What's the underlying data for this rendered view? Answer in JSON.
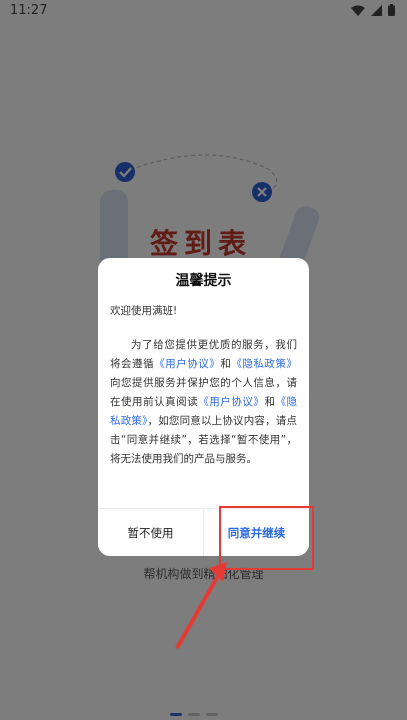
{
  "status_bar": {
    "time": "11:27",
    "icons": [
      "wifi-icon",
      "cellular-signal-icon",
      "battery-icon"
    ]
  },
  "background": {
    "illustration_title": "签到表",
    "caption": "帮机构做到精细化管理",
    "pager": {
      "total": 3,
      "active_index": 0
    }
  },
  "dialog": {
    "title": "温馨提示",
    "greeting": "欢迎使用满班!",
    "body_segments": [
      {
        "text": "为了给您提供更优质的服务，我们将会遵循",
        "link": false
      },
      {
        "text": "《用户协议》",
        "link": true
      },
      {
        "text": "和",
        "link": false
      },
      {
        "text": "《隐私政策》",
        "link": true
      },
      {
        "text": "向您提供服务并保护您的个人信息，请在使用前认真阅读",
        "link": false
      },
      {
        "text": "《用户协议》",
        "link": true
      },
      {
        "text": "和",
        "link": false
      },
      {
        "text": "《隐私政策》",
        "link": true
      },
      {
        "text": "，如您同意以上协议内容，请点击“同意并继续”，若选择“暂不使用”，将无法使用我们的产品与服务。",
        "link": false
      }
    ],
    "decline_label": "暂不使用",
    "accept_label": "同意并继续"
  },
  "colors": {
    "link": "#2d6ce0",
    "highlight": "#e53935",
    "title_red": "#c0392b"
  }
}
